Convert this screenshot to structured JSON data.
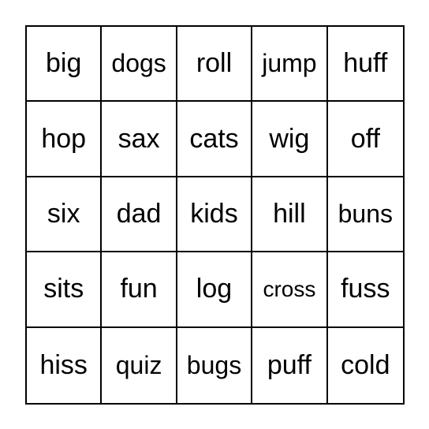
{
  "board": {
    "cells": [
      [
        "big",
        "dogs",
        "roll",
        "jump",
        "huff"
      ],
      [
        "hop",
        "sax",
        "cats",
        "wig",
        "off"
      ],
      [
        "six",
        "dad",
        "kids",
        "hill",
        "buns"
      ],
      [
        "sits",
        "fun",
        "log",
        "cross",
        "fuss"
      ],
      [
        "hiss",
        "quiz",
        "bugs",
        "puff",
        "cold"
      ]
    ]
  }
}
